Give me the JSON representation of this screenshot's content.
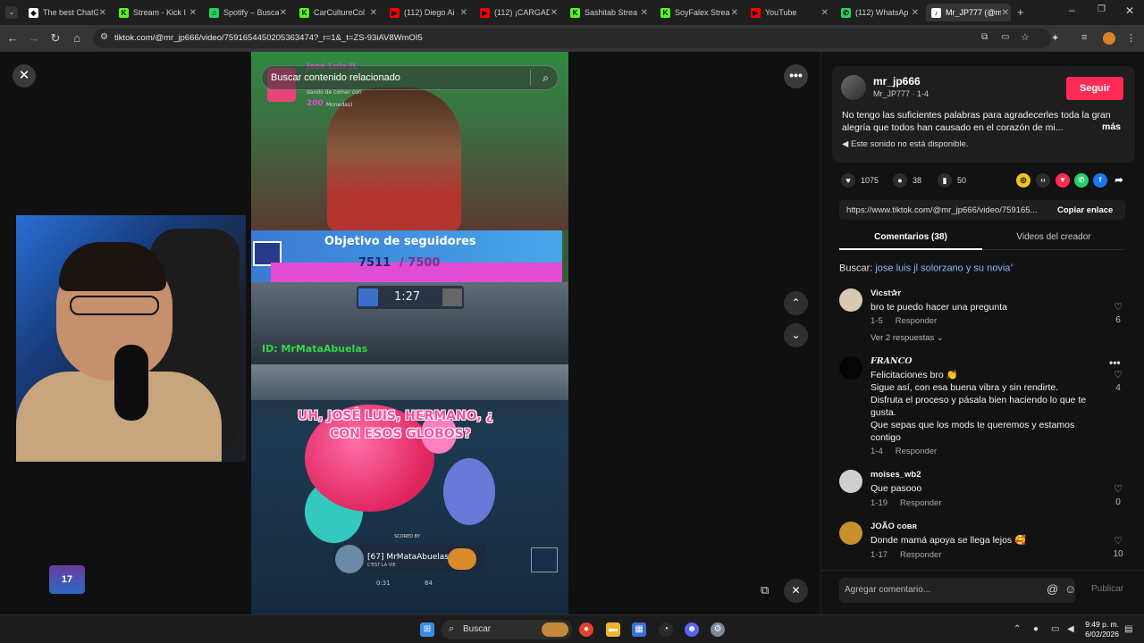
{
  "browser": {
    "tabs": [
      {
        "label": "The best ChatG",
        "fav_color": "#ffffff",
        "fav": "◆"
      },
      {
        "label": "Stream - Kick I",
        "fav_color": "#53fc18",
        "fav": "K"
      },
      {
        "label": "Spotify – Busca",
        "fav_color": "#1ed760",
        "fav": "♫"
      },
      {
        "label": "CarCultureCol",
        "fav_color": "#53fc18",
        "fav": "K"
      },
      {
        "label": "(112) Diego Ai",
        "fav_color": "#ff0000",
        "fav": "▶"
      },
      {
        "label": "(112) ¡CARGAD",
        "fav_color": "#ff0000",
        "fav": "▶"
      },
      {
        "label": "Sashitab Strea",
        "fav_color": "#53fc18",
        "fav": "K"
      },
      {
        "label": "SoyFalex Strea",
        "fav_color": "#53fc18",
        "fav": "K"
      },
      {
        "label": "YouTube",
        "fav_color": "#ff0000",
        "fav": "▶"
      },
      {
        "label": "(112) WhatsAp",
        "fav_color": "#25d366",
        "fav": "✆"
      },
      {
        "label": "Mr_JP777 (@m",
        "fav_color": "#ffffff",
        "fav": "♪"
      }
    ],
    "url": "tiktok.com/@mr_jp666/video/7591654450205363474?_r=1&_t=ZS-93iAV8WmOI5"
  },
  "video": {
    "search_placeholder": "Buscar contenido relacionado",
    "overlay": {
      "gift_user": "José Luis JL",
      "gift_line": "dando de comer con",
      "gift_amount": "200",
      "gift_unit": "Monedas)",
      "goal_title": "Objetivo de seguidores",
      "goal_current": "7511",
      "goal_target": "/ 7500",
      "timer": "1:27",
      "watermark": "ID: MrMataAbuelas",
      "caption_line1": "UH, JOSÉ LUIS, HERMANO, ¿",
      "caption_line2": "CON ESOS GLOBOS?",
      "scoreboard": "[67] MrMataAbuelas",
      "scoreboard_sub": "C'EST LA VIE",
      "scored_by": "SCORED BY",
      "stat1": "0:31",
      "stat2": "84"
    },
    "logo_text": "17"
  },
  "panel": {
    "author_name": "mr_jp666",
    "author_sub": "Mr_JP777 · 1-4",
    "follow_label": "Seguir",
    "description": "No tengo las suficientes palabras para agradecerles toda la gran alegría que todos han causado en el corazón de mi...",
    "more_label": "más",
    "sound_label": "Este sonido no está disponible.",
    "likes": "1075",
    "comments": "38",
    "saves": "50",
    "link": "https://www.tiktok.com/@mr_jp666/video/759165...",
    "copy_label": "Copiar enlace",
    "tab_comments": "Comentarios (38)",
    "tab_creator": "Videos del creador",
    "search_prefix": "Buscar:",
    "search_query": "jose luis jl solorzano y su novia",
    "comments_list": [
      {
        "user": "Vicst✰r",
        "text": "bro te puedo hacer una pregunta",
        "meta": "1-5",
        "reply": "Responder",
        "likes": "6",
        "views": "Ver 2 respuestas ⌄",
        "avatar": "#d9c9b0"
      },
      {
        "user": "FRANCO",
        "text": "Felicitaciones bro 👏\nSigue así, con esa buena vibra y sin rendirte.\nDisfruta el proceso y pásala bien haciendo lo que te gusta.\nQue sepas que los mods te queremos y estamos contigo",
        "meta": "1-4",
        "reply": "Responder",
        "likes": "4",
        "avatar": "#050505"
      },
      {
        "user": "moises_wb2",
        "text": "Que pasooo",
        "meta": "1-19",
        "reply": "Responder",
        "likes": "0",
        "avatar": "#cfcfcf"
      },
      {
        "user": "JOÃO ᴄᴏʙʀ",
        "text": "Donde mamá apoya se llega lejos 🥰",
        "meta": "1-17",
        "reply": "Responder",
        "likes": "10",
        "avatar": "#c8902a"
      }
    ],
    "comment_placeholder": "Agregar comentario...",
    "post_label": "Publicar"
  },
  "taskbar": {
    "search_label": "Buscar",
    "time": "9:49 p. m.",
    "date": "6/02/2026"
  }
}
